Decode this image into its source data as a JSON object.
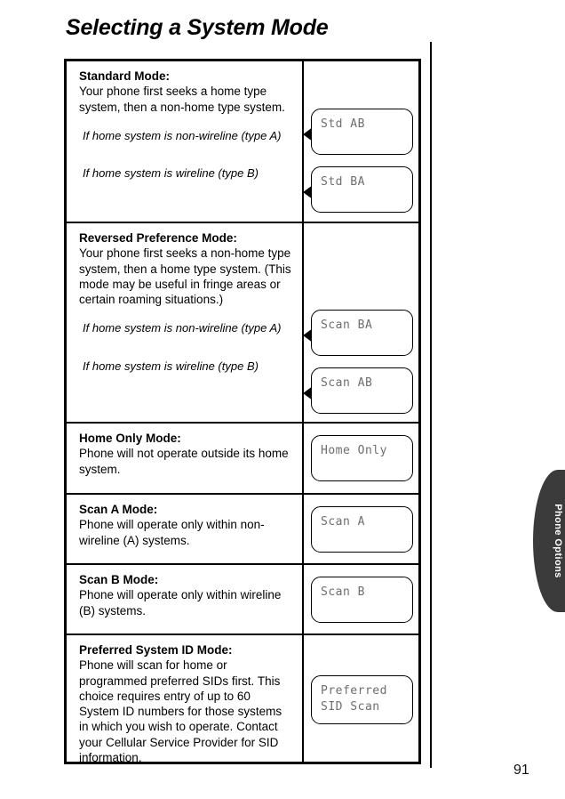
{
  "page": {
    "title": "Selecting a System Mode",
    "number": "91"
  },
  "side_tab": {
    "label": "Phone Options"
  },
  "rows": [
    {
      "title": "Standard Mode:",
      "body": "Your phone first seeks a home type system, then a non-home type system.",
      "conditions": [
        "If home system is non-wireline (type A)",
        "If home system is wireline (type B)"
      ],
      "displays": [
        "Std AB",
        "Std BA"
      ]
    },
    {
      "title": "Reversed Preference Mode:",
      "body": "Your phone first seeks a non-home type system, then a home type system. (This mode may be useful in fringe areas or certain roaming situations.)",
      "conditions": [
        "If home system is non-wireline (type A)",
        "If home system is wireline (type B)"
      ],
      "displays": [
        "Scan BA",
        "Scan AB"
      ]
    },
    {
      "title": "Home Only Mode:",
      "body": "Phone will not operate outside its home system.",
      "conditions": [],
      "displays": [
        "Home Only"
      ]
    },
    {
      "title": "Scan A Mode:",
      "body": "Phone will operate only within non-wireline (A) systems.",
      "conditions": [],
      "displays": [
        "Scan A"
      ]
    },
    {
      "title": "Scan B Mode:",
      "body": "Phone will operate only within wireline (B) systems.",
      "conditions": [],
      "displays": [
        "Scan B"
      ]
    },
    {
      "title": "Preferred System ID Mode:",
      "body": "Phone will scan for home or programmed preferred SIDs first. This choice requires entry of up to 60 System ID numbers for those systems in which you wish to operate. Contact your Cellular Service Provider for SID information.",
      "conditions": [],
      "displays": [
        "Preferred\nSID Scan"
      ]
    }
  ]
}
